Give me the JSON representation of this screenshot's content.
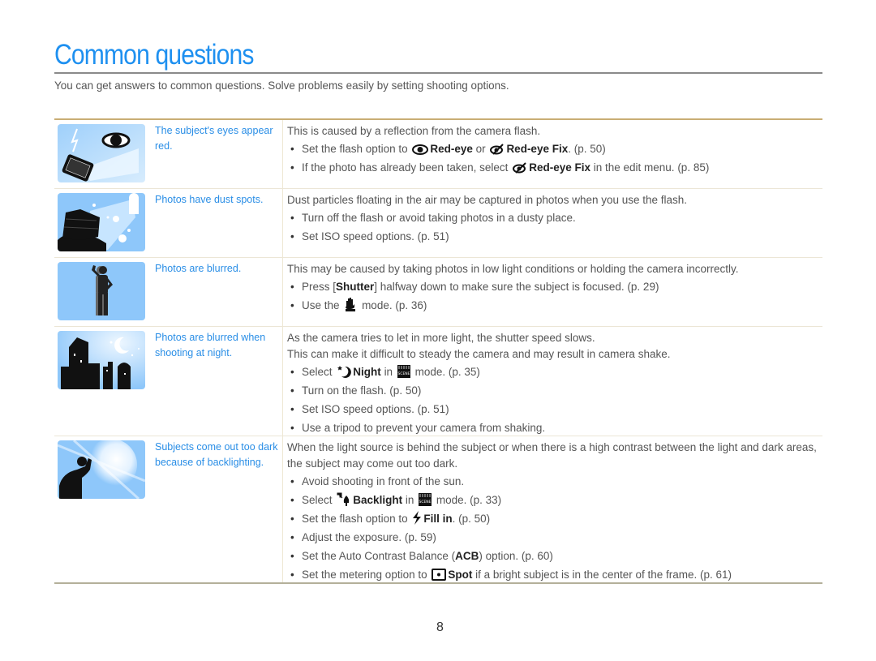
{
  "page": {
    "title": "Common questions",
    "intro": "You can get answers to common questions. Solve problems easily by setting shooting options.",
    "page_number": "8",
    "colors": {
      "accent": "#1e90f0",
      "question": "#2a8ee6",
      "table_top_rule": "#c9ad74"
    }
  },
  "rows": [
    {
      "image": "red-eye-camera-illustration",
      "question": "The subject's eyes appear red.",
      "lead": "This is caused by a reflection from the camera flash.",
      "bullets": {
        "b0": {
          "pre": "Set the flash option to",
          "icon1": "red-eye-icon",
          "bold1": "Red-eye",
          "mid": "or",
          "icon2": "red-eye-fix-icon",
          "bold2": "Red-eye Fix",
          "post": ". (p. 50)"
        },
        "b1": {
          "pre": "If the photo has already been taken, select",
          "icon": "red-eye-fix-icon",
          "bold": "Red-eye Fix",
          "post": "in the edit menu. (p. 85)"
        }
      }
    },
    {
      "image": "dust-spots-illustration",
      "question": "Photos have dust spots.",
      "lead": "Dust particles floating in the air may be captured in photos when you use the flash.",
      "bullets": {
        "b0": {
          "text": "Turn off the flash or avoid taking photos in a dusty place."
        },
        "b1": {
          "text": "Set ISO speed options. (p. 51)"
        }
      }
    },
    {
      "image": "blurred-person-illustration",
      "question": "Photos are blurred.",
      "lead": "This may be caused by taking photos in low light conditions or holding the camera incorrectly.",
      "bullets": {
        "b0": {
          "pre": "Press [",
          "bold": "Shutter",
          "post": "] halfway down to make sure the subject is focused. (p. 29)"
        },
        "b1": {
          "pre": "Use the",
          "icon": "dual-is-hand-icon",
          "post": "mode. (p. 36)"
        }
      }
    },
    {
      "image": "night-city-illustration",
      "question": "Photos are blurred when shooting at night.",
      "lead": "As the camera tries to let in more light, the shutter speed slows.",
      "lead2": "This can make it difficult to steady the camera and may result in camera shake.",
      "bullets": {
        "b0": {
          "pre": "Select",
          "icon1": "night-icon",
          "bold": "Night",
          "mid": "in",
          "icon2": "scene-icon",
          "post": "mode. (p. 35)"
        },
        "b1": {
          "text": "Turn on the flash. (p. 50)"
        },
        "b2": {
          "text": "Set ISO speed options. (p. 51)"
        },
        "b3": {
          "text": "Use a tripod to prevent your camera from shaking."
        }
      }
    },
    {
      "image": "backlit-person-illustration",
      "question": "Subjects come out too dark because of backlighting.",
      "lead": "When the light source is behind the subject or when there is a high contrast between the light and dark areas, the subject may come out too dark.",
      "bullets": {
        "b0": {
          "text": "Avoid shooting in front of the sun."
        },
        "b1": {
          "pre": "Select",
          "icon1": "backlight-icon",
          "bold": "Backlight",
          "mid": "in",
          "icon2": "scene-icon",
          "post": "mode. (p. 33)"
        },
        "b2": {
          "pre": "Set the flash option to",
          "icon": "fill-in-flash-icon",
          "bold": "Fill in",
          "post": ". (p. 50)"
        },
        "b3": {
          "text": "Adjust the exposure. (p. 59)"
        },
        "b4": {
          "pre": "Set the Auto Contrast Balance (",
          "bold": "ACB",
          "post": ") option. (p. 60)"
        },
        "b5": {
          "pre": "Set the metering option to",
          "icon": "spot-metering-icon",
          "bold": "Spot",
          "post": "if a bright subject is in the center of the frame. (p. 61)"
        }
      }
    }
  ]
}
